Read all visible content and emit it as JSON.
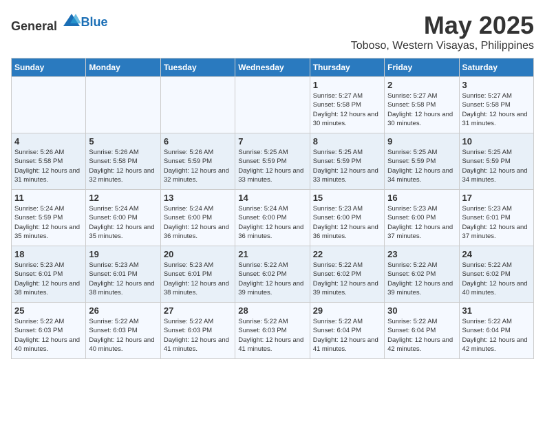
{
  "header": {
    "logo_general": "General",
    "logo_blue": "Blue",
    "title": "May 2025",
    "subtitle": "Toboso, Western Visayas, Philippines"
  },
  "days_of_week": [
    "Sunday",
    "Monday",
    "Tuesday",
    "Wednesday",
    "Thursday",
    "Friday",
    "Saturday"
  ],
  "weeks": [
    [
      {
        "day": "",
        "detail": ""
      },
      {
        "day": "",
        "detail": ""
      },
      {
        "day": "",
        "detail": ""
      },
      {
        "day": "",
        "detail": ""
      },
      {
        "day": "1",
        "detail": "Sunrise: 5:27 AM\nSunset: 5:58 PM\nDaylight: 12 hours\nand 30 minutes."
      },
      {
        "day": "2",
        "detail": "Sunrise: 5:27 AM\nSunset: 5:58 PM\nDaylight: 12 hours\nand 30 minutes."
      },
      {
        "day": "3",
        "detail": "Sunrise: 5:27 AM\nSunset: 5:58 PM\nDaylight: 12 hours\nand 31 minutes."
      }
    ],
    [
      {
        "day": "4",
        "detail": "Sunrise: 5:26 AM\nSunset: 5:58 PM\nDaylight: 12 hours\nand 31 minutes."
      },
      {
        "day": "5",
        "detail": "Sunrise: 5:26 AM\nSunset: 5:58 PM\nDaylight: 12 hours\nand 32 minutes."
      },
      {
        "day": "6",
        "detail": "Sunrise: 5:26 AM\nSunset: 5:59 PM\nDaylight: 12 hours\nand 32 minutes."
      },
      {
        "day": "7",
        "detail": "Sunrise: 5:25 AM\nSunset: 5:59 PM\nDaylight: 12 hours\nand 33 minutes."
      },
      {
        "day": "8",
        "detail": "Sunrise: 5:25 AM\nSunset: 5:59 PM\nDaylight: 12 hours\nand 33 minutes."
      },
      {
        "day": "9",
        "detail": "Sunrise: 5:25 AM\nSunset: 5:59 PM\nDaylight: 12 hours\nand 34 minutes."
      },
      {
        "day": "10",
        "detail": "Sunrise: 5:25 AM\nSunset: 5:59 PM\nDaylight: 12 hours\nand 34 minutes."
      }
    ],
    [
      {
        "day": "11",
        "detail": "Sunrise: 5:24 AM\nSunset: 5:59 PM\nDaylight: 12 hours\nand 35 minutes."
      },
      {
        "day": "12",
        "detail": "Sunrise: 5:24 AM\nSunset: 6:00 PM\nDaylight: 12 hours\nand 35 minutes."
      },
      {
        "day": "13",
        "detail": "Sunrise: 5:24 AM\nSunset: 6:00 PM\nDaylight: 12 hours\nand 36 minutes."
      },
      {
        "day": "14",
        "detail": "Sunrise: 5:24 AM\nSunset: 6:00 PM\nDaylight: 12 hours\nand 36 minutes."
      },
      {
        "day": "15",
        "detail": "Sunrise: 5:23 AM\nSunset: 6:00 PM\nDaylight: 12 hours\nand 36 minutes."
      },
      {
        "day": "16",
        "detail": "Sunrise: 5:23 AM\nSunset: 6:00 PM\nDaylight: 12 hours\nand 37 minutes."
      },
      {
        "day": "17",
        "detail": "Sunrise: 5:23 AM\nSunset: 6:01 PM\nDaylight: 12 hours\nand 37 minutes."
      }
    ],
    [
      {
        "day": "18",
        "detail": "Sunrise: 5:23 AM\nSunset: 6:01 PM\nDaylight: 12 hours\nand 38 minutes."
      },
      {
        "day": "19",
        "detail": "Sunrise: 5:23 AM\nSunset: 6:01 PM\nDaylight: 12 hours\nand 38 minutes."
      },
      {
        "day": "20",
        "detail": "Sunrise: 5:23 AM\nSunset: 6:01 PM\nDaylight: 12 hours\nand 38 minutes."
      },
      {
        "day": "21",
        "detail": "Sunrise: 5:22 AM\nSunset: 6:02 PM\nDaylight: 12 hours\nand 39 minutes."
      },
      {
        "day": "22",
        "detail": "Sunrise: 5:22 AM\nSunset: 6:02 PM\nDaylight: 12 hours\nand 39 minutes."
      },
      {
        "day": "23",
        "detail": "Sunrise: 5:22 AM\nSunset: 6:02 PM\nDaylight: 12 hours\nand 39 minutes."
      },
      {
        "day": "24",
        "detail": "Sunrise: 5:22 AM\nSunset: 6:02 PM\nDaylight: 12 hours\nand 40 minutes."
      }
    ],
    [
      {
        "day": "25",
        "detail": "Sunrise: 5:22 AM\nSunset: 6:03 PM\nDaylight: 12 hours\nand 40 minutes."
      },
      {
        "day": "26",
        "detail": "Sunrise: 5:22 AM\nSunset: 6:03 PM\nDaylight: 12 hours\nand 40 minutes."
      },
      {
        "day": "27",
        "detail": "Sunrise: 5:22 AM\nSunset: 6:03 PM\nDaylight: 12 hours\nand 41 minutes."
      },
      {
        "day": "28",
        "detail": "Sunrise: 5:22 AM\nSunset: 6:03 PM\nDaylight: 12 hours\nand 41 minutes."
      },
      {
        "day": "29",
        "detail": "Sunrise: 5:22 AM\nSunset: 6:04 PM\nDaylight: 12 hours\nand 41 minutes."
      },
      {
        "day": "30",
        "detail": "Sunrise: 5:22 AM\nSunset: 6:04 PM\nDaylight: 12 hours\nand 42 minutes."
      },
      {
        "day": "31",
        "detail": "Sunrise: 5:22 AM\nSunset: 6:04 PM\nDaylight: 12 hours\nand 42 minutes."
      }
    ]
  ]
}
